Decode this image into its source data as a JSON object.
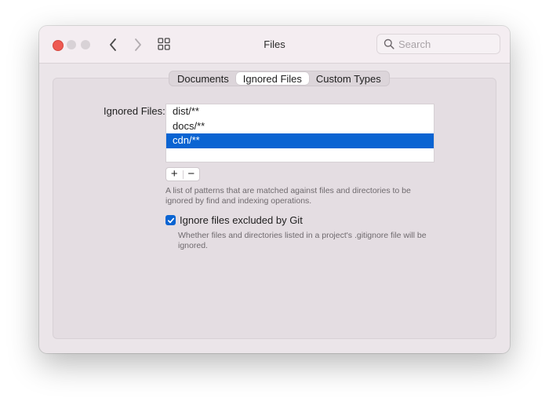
{
  "window": {
    "title": "Files"
  },
  "toolbar": {
    "back_icon": "chevron-left-icon",
    "forward_icon": "chevron-right-icon",
    "grid_icon": "grid-icon",
    "search": {
      "placeholder": "Search",
      "icon": "search-icon"
    }
  },
  "tabs": [
    {
      "label": "Documents",
      "active": false
    },
    {
      "label": "Ignored Files",
      "active": true
    },
    {
      "label": "Custom Types",
      "active": false
    }
  ],
  "ignored_files": {
    "label": "Ignored Files:",
    "items": [
      {
        "text": "dist/**",
        "selected": false
      },
      {
        "text": "docs/**",
        "selected": false
      },
      {
        "text": "cdn/**",
        "selected": true
      }
    ],
    "add_label": "+",
    "remove_label": "−",
    "help": "A list of patterns that are matched against files and directories to be ignored by find and indexing operations."
  },
  "git_option": {
    "checked": true,
    "label": "Ignore files excluded by Git",
    "help": "Whether files and directories listed in a project's .gitignore file will be ignored."
  },
  "colors": {
    "accent": "#0a64d2",
    "close": "#ee5a52"
  }
}
